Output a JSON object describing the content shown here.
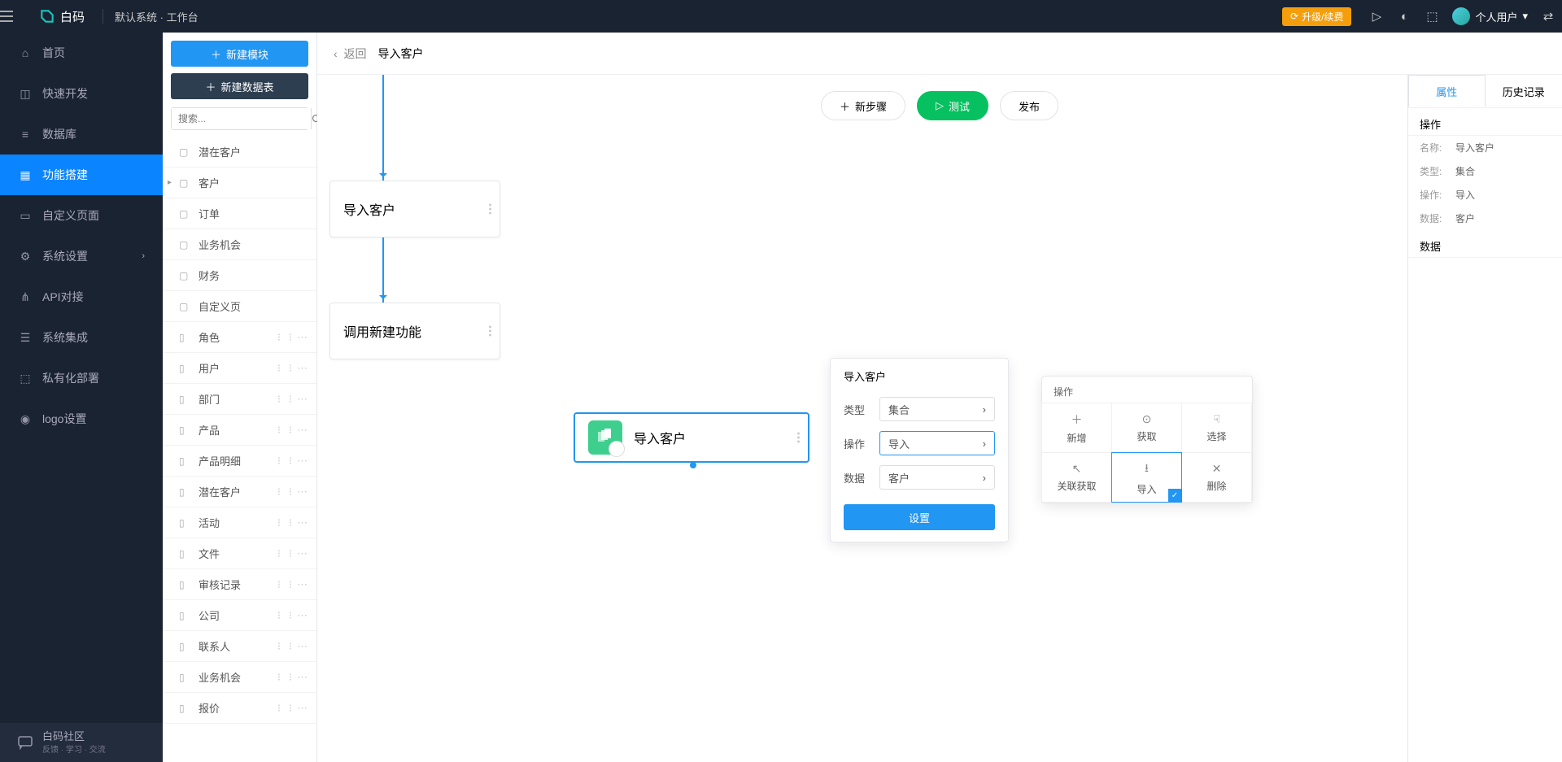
{
  "topbar": {
    "brand": "白码",
    "crumb": "默认系统 · 工作台",
    "upgrade": "升级/续费",
    "user": "个人用户"
  },
  "mainnav": {
    "items": [
      {
        "label": "首页",
        "icon": "home"
      },
      {
        "label": "快速开发",
        "icon": "cube"
      },
      {
        "label": "数据库",
        "icon": "db"
      },
      {
        "label": "功能搭建",
        "icon": "build",
        "active": true
      },
      {
        "label": "自定义页面",
        "icon": "page"
      },
      {
        "label": "系统设置",
        "icon": "gear",
        "chev": true
      },
      {
        "label": "API对接",
        "icon": "api"
      },
      {
        "label": "系统集成",
        "icon": "layers"
      },
      {
        "label": "私有化部署",
        "icon": "deploy"
      },
      {
        "label": "logo设置",
        "icon": "logo"
      }
    ],
    "footer_title": "白码社区",
    "footer_sub": "反馈 · 学习 · 交流"
  },
  "secpanel": {
    "new_module": "新建模块",
    "new_table": "新建数据表",
    "search_ph": "搜索...",
    "tree": [
      {
        "type": "folder",
        "label": "潜在客户"
      },
      {
        "type": "folder",
        "label": "客户",
        "expandable": true
      },
      {
        "type": "folder",
        "label": "订单"
      },
      {
        "type": "folder",
        "label": "业务机会"
      },
      {
        "type": "folder",
        "label": "财务"
      },
      {
        "type": "folder",
        "label": "自定义页"
      },
      {
        "type": "doc",
        "label": "角色"
      },
      {
        "type": "doc",
        "label": "用户"
      },
      {
        "type": "doc",
        "label": "部门"
      },
      {
        "type": "doc",
        "label": "产品"
      },
      {
        "type": "doc",
        "label": "产品明细"
      },
      {
        "type": "doc",
        "label": "潜在客户"
      },
      {
        "type": "doc",
        "label": "活动"
      },
      {
        "type": "doc",
        "label": "文件"
      },
      {
        "type": "doc",
        "label": "审核记录"
      },
      {
        "type": "doc",
        "label": "公司"
      },
      {
        "type": "doc",
        "label": "联系人"
      },
      {
        "type": "doc",
        "label": "业务机会"
      },
      {
        "type": "doc",
        "label": "报价"
      }
    ]
  },
  "content": {
    "back": "返回",
    "title": "导入客户",
    "toolbar": {
      "new_step": "新步骤",
      "test": "测试",
      "publish": "发布"
    },
    "nodes": {
      "n1": "导入客户",
      "n2": "调用新建功能",
      "n3": "导入客户"
    }
  },
  "popover": {
    "title": "导入客户",
    "rows": [
      {
        "label": "类型",
        "value": "集合"
      },
      {
        "label": "操作",
        "value": "导入",
        "hl": true
      },
      {
        "label": "数据",
        "value": "客户"
      }
    ],
    "submit": "设置"
  },
  "opsbox": {
    "title": "操作",
    "cells": [
      {
        "label": "新增",
        "icon": "＋"
      },
      {
        "label": "获取",
        "icon": "⊙"
      },
      {
        "label": "选择",
        "icon": "☟"
      },
      {
        "label": "关联获取",
        "icon": "↖"
      },
      {
        "label": "导入",
        "icon": "⭳",
        "sel": true
      },
      {
        "label": "删除",
        "icon": "✕"
      }
    ]
  },
  "rpanel": {
    "tabs": [
      "属性",
      "历史记录"
    ],
    "sect1": "操作",
    "rows": [
      {
        "k": "名称:",
        "v": "导入客户"
      },
      {
        "k": "类型:",
        "v": "集合"
      },
      {
        "k": "操作:",
        "v": "导入"
      },
      {
        "k": "数据:",
        "v": "客户"
      }
    ],
    "sect2": "数据"
  }
}
